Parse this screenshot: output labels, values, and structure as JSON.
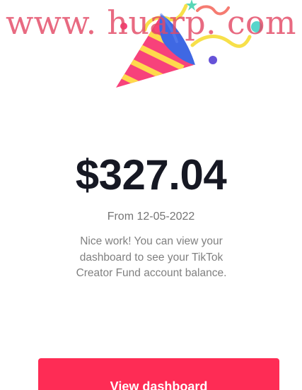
{
  "watermark": {
    "text": "www. huarp. com",
    "color": "#e34a66"
  },
  "illustration": {
    "icon": "party-popper-icon",
    "colors": {
      "cone_pink": "#f7427b",
      "cone_yellow": "#ffd94c",
      "cone_blue": "#3f68e3",
      "streamer_yellow": "#f7e04a",
      "dot_purple": "#6652d8",
      "dot_teal": "#57d5cb",
      "star_green": "#58d7b7"
    }
  },
  "payout": {
    "amount": "$327.04",
    "from_date": "From 12-05-2022",
    "description": "Nice work! You can view your dashboard to see your TikTok Creator Fund account balance."
  },
  "actions": {
    "view_dashboard_label": "View dashboard"
  },
  "theme": {
    "accent": "#fe2c55",
    "text_primary": "#161823",
    "text_secondary": "#757575"
  }
}
